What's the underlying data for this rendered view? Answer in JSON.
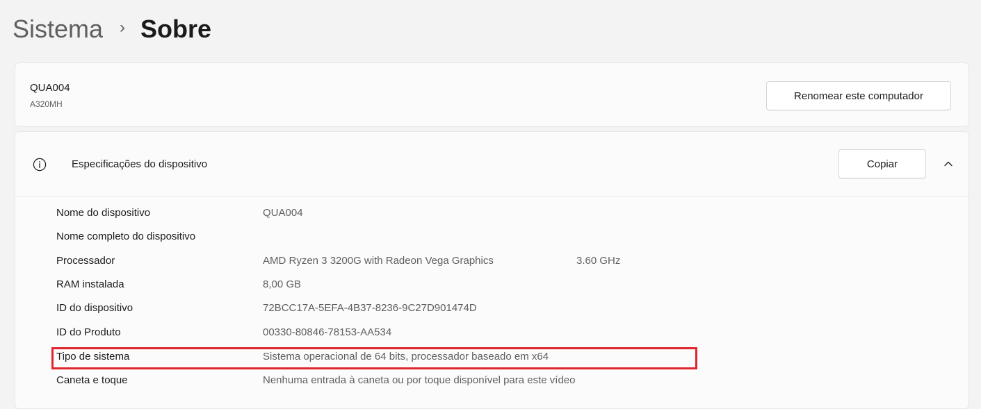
{
  "breadcrumb": {
    "parent": "Sistema",
    "separator": "›",
    "current": "Sobre"
  },
  "device": {
    "name": "QUA004",
    "model": "A320MH",
    "rename_label": "Renomear este computador"
  },
  "specs": {
    "title": "Especificações do dispositivo",
    "copy_label": "Copiar",
    "rows": [
      {
        "label": "Nome do dispositivo",
        "value": "QUA004",
        "extra": ""
      },
      {
        "label": "Nome completo do dispositivo",
        "value": "",
        "extra": ""
      },
      {
        "label": "Processador",
        "value": "AMD Ryzen 3 3200G with Radeon Vega Graphics",
        "extra": "3.60 GHz"
      },
      {
        "label": "RAM instalada",
        "value": "8,00 GB",
        "extra": ""
      },
      {
        "label": "ID do dispositivo",
        "value": "72BCC17A-5EFA-4B37-8236-9C27D901474D",
        "extra": ""
      },
      {
        "label": "ID do Produto",
        "value": "00330-80846-78153-AA534",
        "extra": ""
      },
      {
        "label": "Tipo de sistema",
        "value": "Sistema operacional de 64 bits, processador baseado em x64",
        "extra": ""
      },
      {
        "label": "Caneta e toque",
        "value": "Nenhuma entrada à caneta ou por toque disponível para este vídeo",
        "extra": ""
      }
    ]
  },
  "colors": {
    "highlight": "#e0252d",
    "background": "#f3f3f3",
    "card": "#fbfbfb"
  }
}
